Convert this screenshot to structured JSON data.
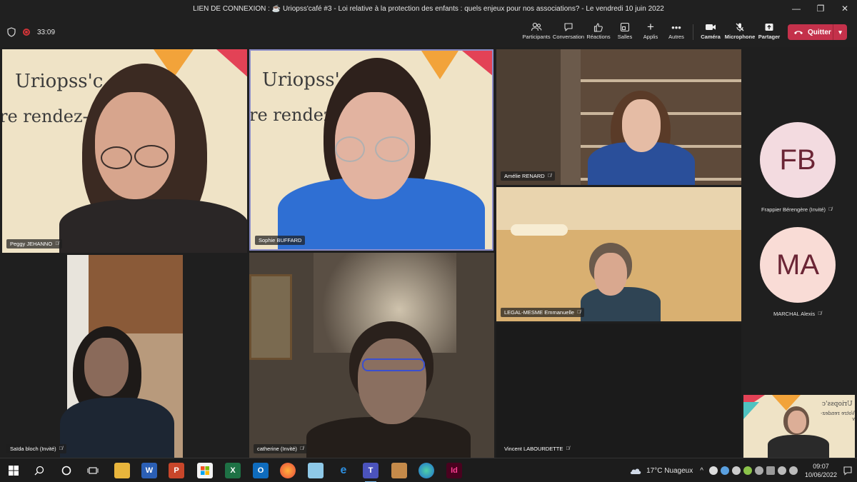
{
  "window": {
    "title": "LIEN DE CONNEXION : ☕ Uriopss'café #3 - Loi relative à la protection des enfants : quels enjeux pour nos associations? - Le vendredi 10 juin 2022",
    "controls": {
      "minimize": "—",
      "restore": "❐",
      "close": "✕"
    }
  },
  "toolbar": {
    "timer": "33:09",
    "items": [
      {
        "label": "Participants",
        "icon": "participants-icon"
      },
      {
        "label": "Conversation",
        "icon": "chat-icon"
      },
      {
        "label": "Réactions",
        "icon": "reactions-icon"
      },
      {
        "label": "Salles",
        "icon": "rooms-icon"
      },
      {
        "label": "Applis",
        "icon": "apps-icon"
      },
      {
        "label": "Autres",
        "icon": "more-icon"
      }
    ],
    "media": [
      {
        "label": "Caméra",
        "icon": "camera-icon"
      },
      {
        "label": "Microphone",
        "icon": "mic-off-icon"
      },
      {
        "label": "Partager",
        "icon": "share-icon"
      }
    ],
    "quit_label": "Quitter"
  },
  "participants": [
    {
      "name": "Peggy JEHANNO",
      "muted": true
    },
    {
      "name": "Sophie BUFFARD",
      "muted": false,
      "active": true
    },
    {
      "name": "Amélie RENARD",
      "muted": true
    },
    {
      "name": "LEGAL-MESME Emmanuelle",
      "muted": true
    },
    {
      "name": "Saïda bloch (Invité)",
      "muted": true
    },
    {
      "name": "catherine (Invité)",
      "muted": true
    },
    {
      "name": "Vincent LABOURDETTE",
      "muted": true
    }
  ],
  "background_text": {
    "line1": "Uriopss'c",
    "line2": "re rendez-",
    "line2b": "re rendez-vous en"
  },
  "rail": [
    {
      "initials": "FB",
      "name": "Frappier Bérengère (Invité)",
      "color": "#f3dbe0"
    },
    {
      "initials": "MA",
      "name": "MARCHAL Alexis",
      "color": "#f9dcd6"
    }
  ],
  "self_view": {
    "text1": "Uriopss'c",
    "text2": "Votre rendez-v"
  },
  "taskbar": {
    "weather": "17°C  Nuageux",
    "time": "09:07",
    "date": "10/06/2022"
  }
}
